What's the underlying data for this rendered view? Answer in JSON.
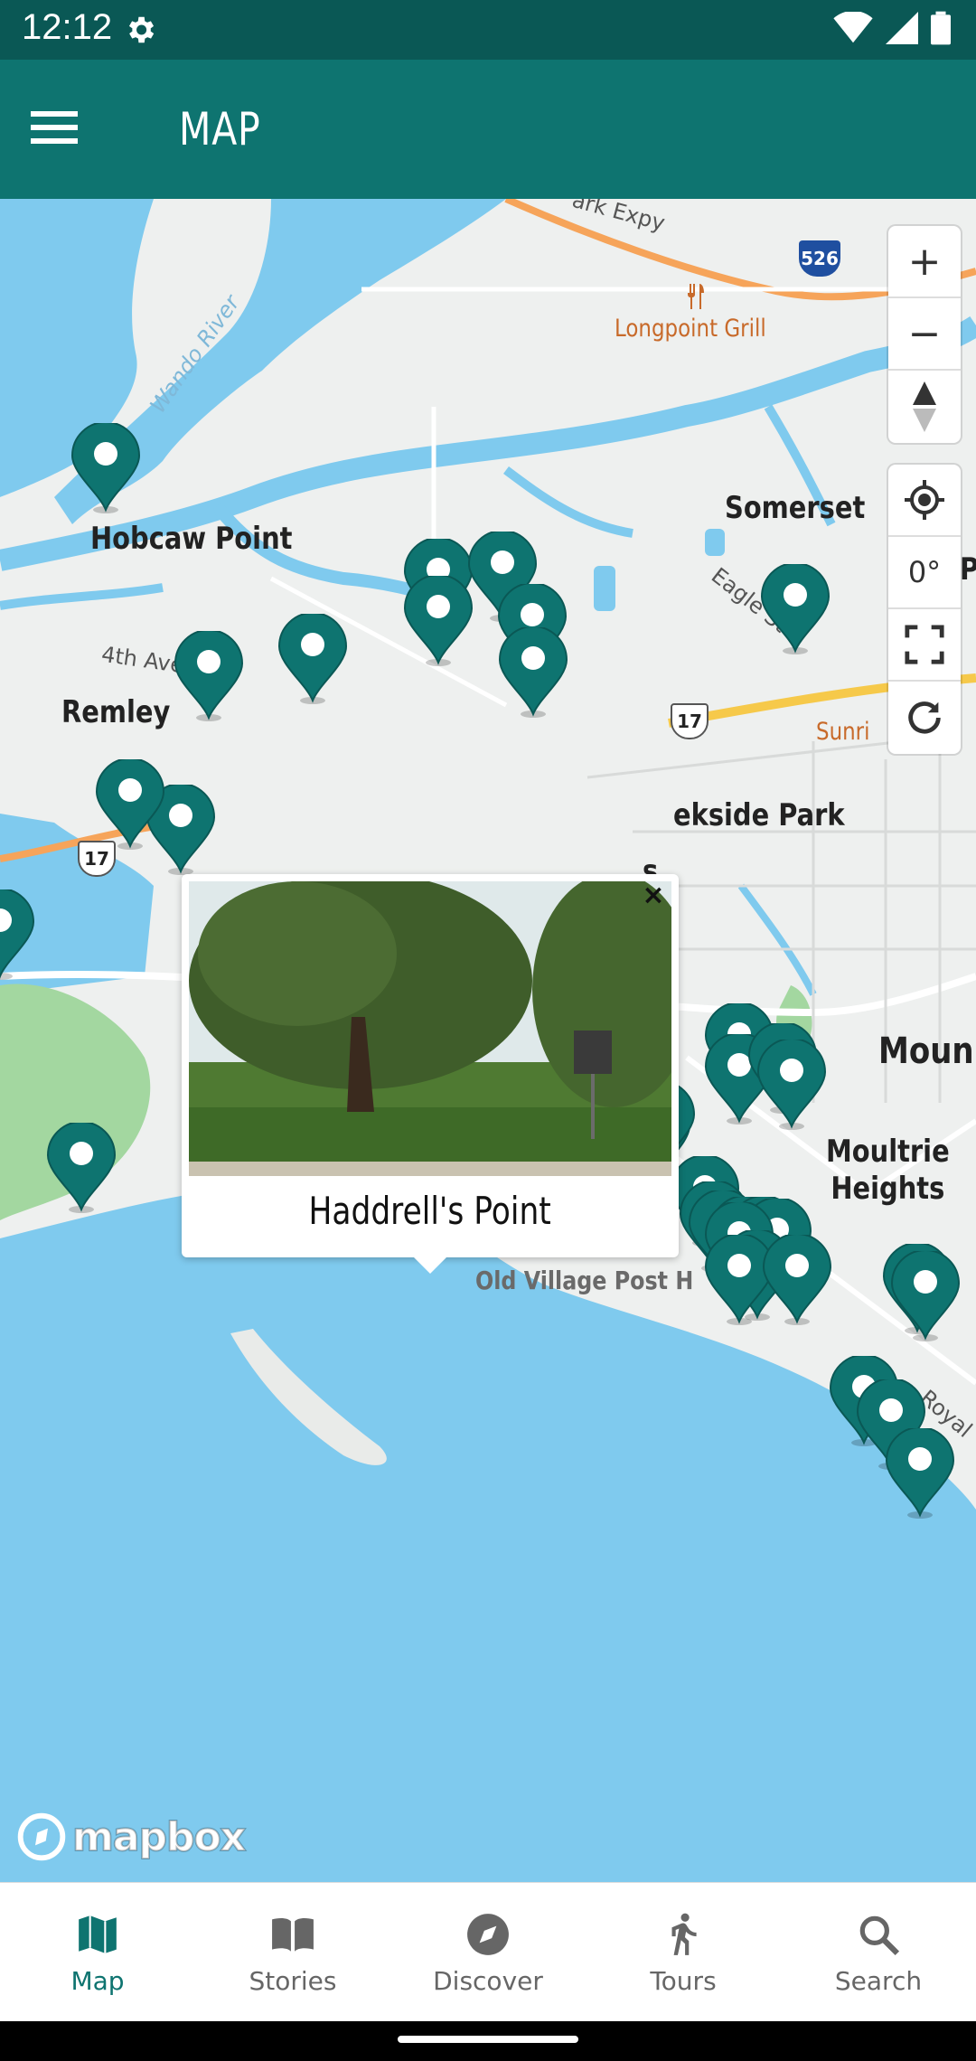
{
  "status_bar": {
    "time": "12:12"
  },
  "app_bar": {
    "title": "MAP"
  },
  "map": {
    "labels": {
      "hobcaw_point": "Hobcaw Point",
      "remley": "Remley",
      "somerset": "Somerset",
      "creekside_park": "ekside Park",
      "moultrie_heights": "Moultrie\nHeights",
      "mount": "Moun",
      "longpoint_grill": "Longpoint Grill",
      "old_village": "Old Village Post H",
      "sunrise": "Sunri",
      "fourth_ave": "4th Ave",
      "eagle_st": "Eagle St",
      "wando_river": "Wando River",
      "expy": "ark Expy",
      "royal": "Royal",
      "s_partial": "s",
      "p_partial": "P",
      "shield_526": "526",
      "shield_17a": "17",
      "shield_17b": "17"
    },
    "popup": {
      "title": "Haddrell's Point",
      "close": "×"
    },
    "controls": {
      "zoom_in": "+",
      "zoom_out": "−",
      "bearing": "0°"
    },
    "attribution": "mapbox"
  },
  "nav": {
    "items": [
      {
        "label": "Map",
        "icon": "map-icon"
      },
      {
        "label": "Stories",
        "icon": "book-icon"
      },
      {
        "label": "Discover",
        "icon": "compass-icon"
      },
      {
        "label": "Tours",
        "icon": "walking-icon"
      },
      {
        "label": "Search",
        "icon": "search-icon"
      }
    ]
  },
  "colors": {
    "primary": "#0e7470",
    "status": "#0a5855",
    "water": "#7fcaee",
    "park": "#a3d7a0"
  }
}
